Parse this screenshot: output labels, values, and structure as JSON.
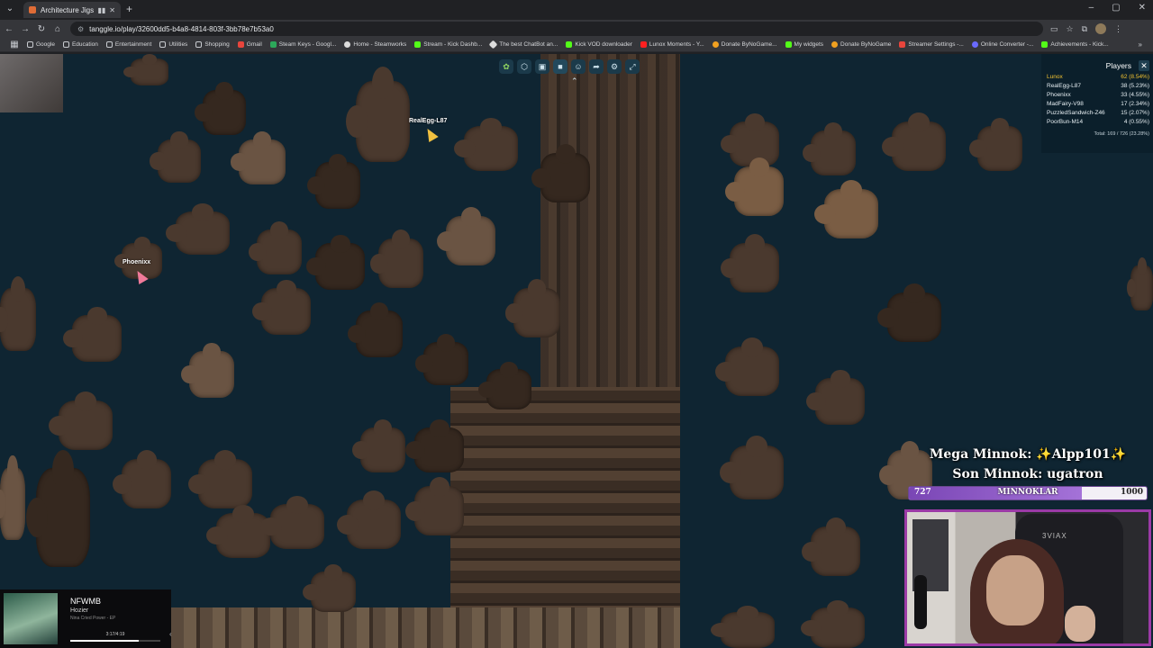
{
  "browser": {
    "tab_title": "Architecture Jigsaw Pu",
    "url": "tanggle.io/play/32600dd5-b4a8-4814-803f-3bb78e7b53a0",
    "bookmarks": [
      "Google",
      "Education",
      "Entertainment",
      "Utilities",
      "Shopping",
      "Gmail",
      "Steam Keys - Googl...",
      "Home - Steamworks",
      "Stream - Kick Dashb...",
      "The best ChatBot an...",
      "Kick VOD downloader",
      "Lunox Moments - Y...",
      "Donate ByNoGame...",
      "My widgets",
      "Donate ByNoGame",
      "Streamer Settings -...",
      "Online Converter -...",
      "Achievements - Kick..."
    ],
    "bookmark_colors": [
      "#f5c542",
      "#f5c542",
      "#f5c542",
      "#f5c542",
      "#f5c542",
      "#e8453c",
      "#3a9bdc",
      "#dcdcdc",
      "#53fc18",
      "#dcdcdc",
      "#53fc18",
      "#ff2020",
      "#f0a020",
      "#53fc18",
      "#f0a020",
      "#e8453c",
      "#6a6aff",
      "#53fc18"
    ]
  },
  "game": {
    "cursors": [
      {
        "name": "RealEgg-L87",
        "color": "yellow"
      },
      {
        "name": "Phoenixx",
        "color": "pink"
      }
    ],
    "toolbar_icons": [
      "sort-icon",
      "box-icon",
      "image-icon",
      "background-icon",
      "players-icon",
      "share-icon",
      "settings-icon",
      "fullscreen-icon"
    ]
  },
  "players_panel": {
    "title": "Players",
    "players": [
      {
        "name": "Lunox",
        "score": "62 (8.54%)"
      },
      {
        "name": "RealEgg-L87",
        "score": "38 (5.23%)"
      },
      {
        "name": "Phoenixx",
        "score": "33 (4.55%)"
      },
      {
        "name": "MadFairy-V98",
        "score": "17 (2.34%)"
      },
      {
        "name": "PuzzledSandwich-Z46",
        "score": "15 (2.07%)"
      },
      {
        "name": "PoorBun-M14",
        "score": "4 (0.55%)"
      }
    ],
    "total": "Total: 169 / 726 (23.28%)"
  },
  "stream_overlay": {
    "mega_line": "Mega Minnok: ✨Alpp101✨",
    "son_line": "Son Minnok: ugatron",
    "goal_current": "727",
    "goal_label": "MINNOKLAR",
    "goal_target": "1000",
    "goal_progress": 0.727,
    "webcam_chair_brand": "3VIAX"
  },
  "now_playing": {
    "title": "NFWMB",
    "artist": "Hozier",
    "album": "Nina Cried Power - EP",
    "time": "3:17/4:19",
    "progress": 0.76
  }
}
